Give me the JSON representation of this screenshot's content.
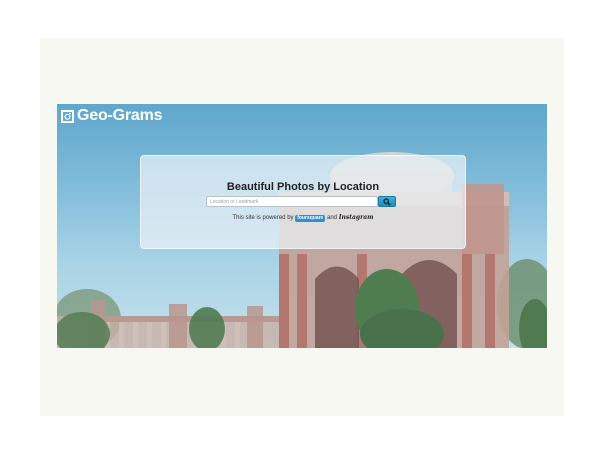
{
  "app": {
    "logo_text": "Geo-Grams",
    "logo_icon": "instagram-camera-icon"
  },
  "hero": {
    "title": "Beautiful Photos by Location",
    "search": {
      "placeholder": "Location or Landmark",
      "value": "",
      "button_icon": "search-icon"
    },
    "powered": {
      "prefix": "This site is powered by",
      "foursquare_label": "foursquare",
      "conjunction": "and",
      "instagram_label": "Instagram"
    }
  },
  "colors": {
    "sky_top": "#4f9ec6",
    "accent_button": "#2a9dcc",
    "foursquare_blue": "#2e8fd1"
  }
}
